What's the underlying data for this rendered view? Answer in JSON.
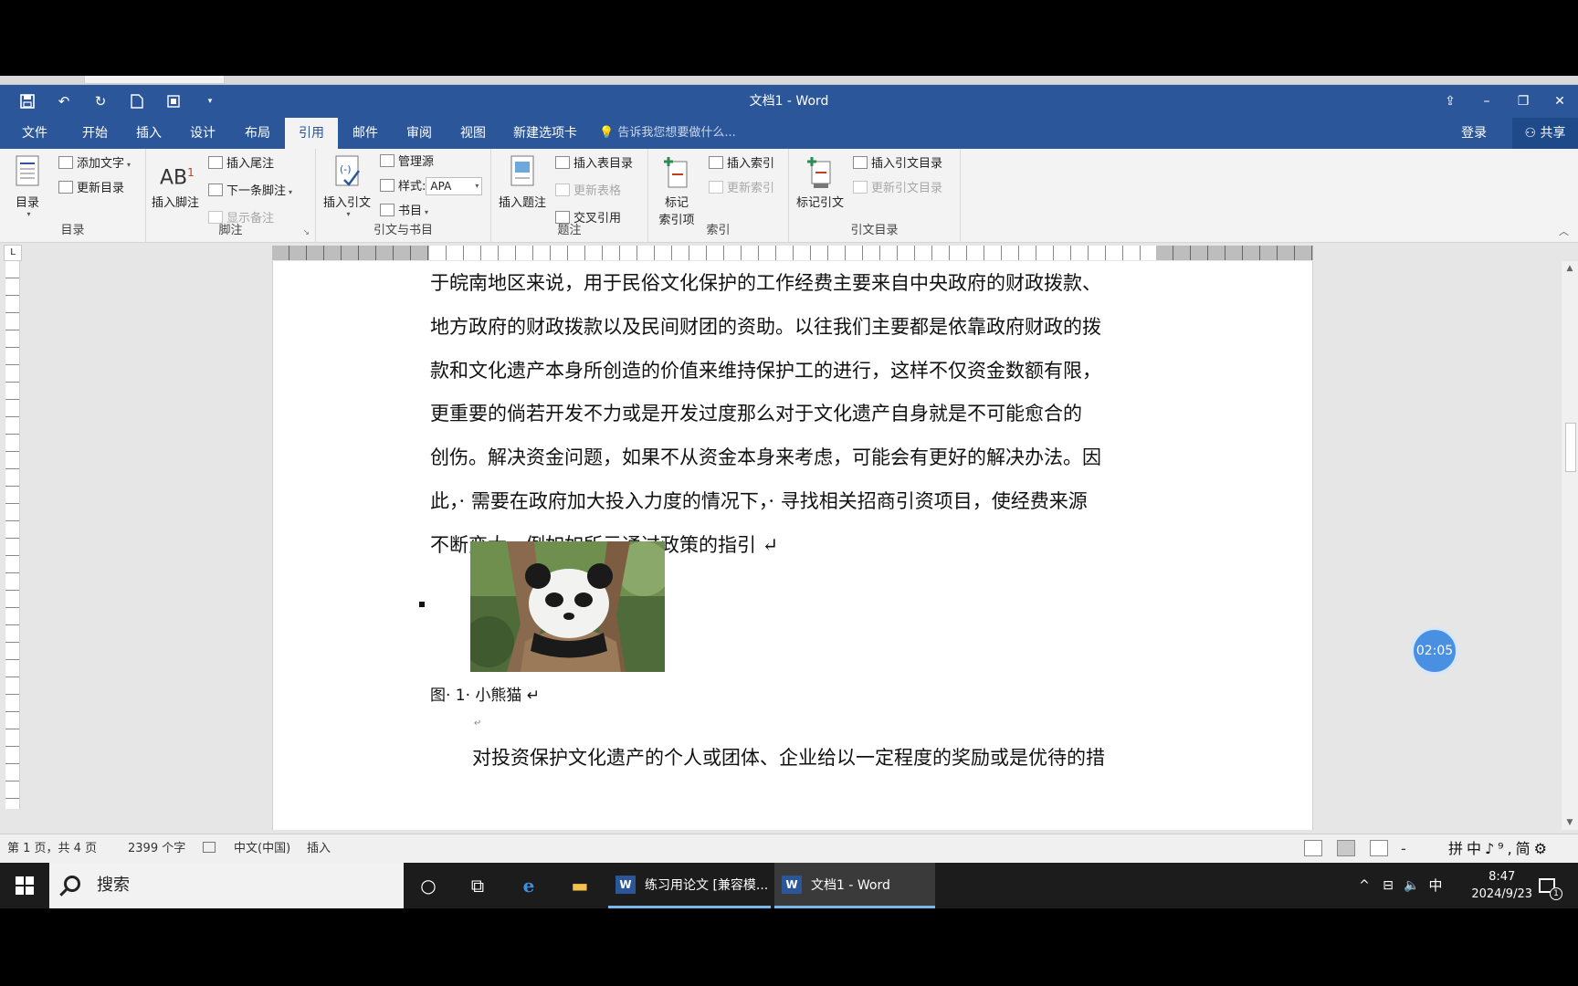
{
  "window": {
    "title": "文档1 - Word"
  },
  "qat": {
    "save_icon": "save-icon",
    "undo_icon": "undo-icon",
    "redo_icon": "redo-icon",
    "new_icon": "new-doc-icon",
    "print_icon": "print-preview-icon",
    "customize_icon": "qat-customize-icon"
  },
  "win_controls": {
    "ribbon_display": "⇪",
    "minimize": "–",
    "restore": "❐",
    "close": "✕"
  },
  "tabs": [
    "文件",
    "开始",
    "插入",
    "设计",
    "布局",
    "引用",
    "邮件",
    "审阅",
    "视图",
    "新建选项卡"
  ],
  "active_tab": "引用",
  "tellme": "告诉我您想要做什么...",
  "login": "登录",
  "share": "共享",
  "ribbon": {
    "toc": {
      "label": "目录",
      "add_text": "添加文字",
      "update_toc": "更新目录",
      "group": "目录"
    },
    "footnotes": {
      "insert_footnote": "插入脚注",
      "insert_endnote": "插入尾注",
      "next_footnote": "下一条脚注",
      "show_notes": "显示备注",
      "group": "脚注"
    },
    "citations": {
      "insert_citation": "插入引文",
      "manage_sources": "管理源",
      "style_label": "样式:",
      "style_value": "APA",
      "bibliography": "书目",
      "group": "引文与书目"
    },
    "captions": {
      "insert_caption": "插入题注",
      "insert_table_of_figures": "插入表目录",
      "update_table": "更新表格",
      "cross_reference": "交叉引用",
      "group": "题注"
    },
    "index": {
      "mark_entry": "标记\n索引项",
      "mark_entry_l1": "标记",
      "mark_entry_l2": "索引项",
      "insert_index": "插入索引",
      "update_index": "更新索引",
      "group": "索引"
    },
    "authorities": {
      "mark_citation": "标记引文",
      "insert_toa": "插入引文目录",
      "update_toa": "更新引文目录",
      "group": "引文目录"
    }
  },
  "document": {
    "lines": [
      "于皖南地区来说，用于民俗文化保护的工作经费主要来自中央政府的财政拨款、",
      "地方政府的财政拨款以及民间财团的资助。以往我们主要都是依靠政府财政的拨",
      "款和文化遗产本身所创造的价值来维持保护工的进行，这样不仅资金数额有限，",
      "更重要的倘若开发不力或是开发过度那么对于文化遗产自身就是不可能愈合的",
      "创伤。解决资金问题，如果不从资金本身来考虑，可能会有更好的解决办法。因",
      "此，· 需要在政府加大投入力度的情况下，· 寻找相关招商引资项目，使经费来源",
      "不断变大。例如如所示通过政策的指引 ↵"
    ],
    "caption": "图· 1· 小熊猫 ↵",
    "para_mark": "↵",
    "last_line": "对投资保护文化遗产的个人或团体、企业给以一定程度的奖励或是优待的措"
  },
  "timer": "02:05",
  "status": {
    "page": "第 1 页，共 4 页",
    "words": "2399 个字",
    "language": "中文(中国)",
    "mode": "插入",
    "zoom_minus": "-",
    "ime_tools": "拼中♪⁹,简⚙"
  },
  "taskbar": {
    "search": "搜索",
    "apps": [
      {
        "label": "练习用论文 [兼容模...",
        "active": false
      },
      {
        "label": "文档1 - Word",
        "active": true
      }
    ],
    "ime": "中",
    "time": "8:47",
    "date": "2024/9/23",
    "notif": "1"
  },
  "colors": {
    "word_blue": "#2b579a",
    "active_tab_bg": "#f3f3f3",
    "timer": "#4a90e2"
  }
}
